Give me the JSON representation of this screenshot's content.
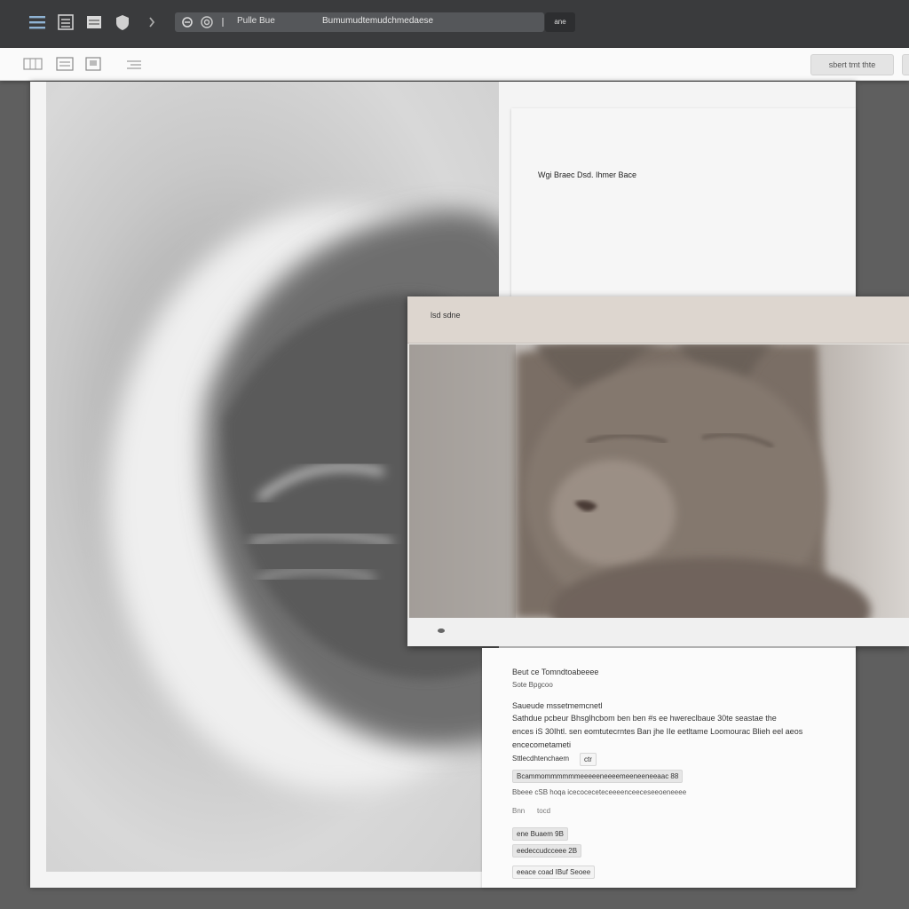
{
  "topbar": {
    "search_text_1": "Pulle Bue",
    "search_text_2": "Bumumudtemudchmedaese",
    "zoom_label": "ane",
    "icons": [
      "menu-icon",
      "list-icon",
      "document-icon",
      "shield-icon",
      "chevron-icon",
      "link-icon",
      "target-icon",
      "text-cursor-icon"
    ]
  },
  "toolbar": {
    "button_label": "sbert tmt thte",
    "icons": [
      "grid-icon",
      "image-icon",
      "frame-icon",
      "align-icon"
    ]
  },
  "doc_top": {
    "title": "Wgi Braec Dsd. Ihmer Bace"
  },
  "image_window": {
    "title": "lsd sdne"
  },
  "doc_bottom": {
    "line1": "Beut ce Tomndtoabeeee",
    "line2": "Sote Bpgcoo",
    "line3": "Saueude mssetmemcnetl",
    "line4": "Sathdue pcbeur Bhsglhcbom ben ben #s ee hwereclbaue 30te seastae the",
    "line5": "ences iS 30Ihtl. sen eomtutecrntes Ban jhe IIe eetltame Loomourac Blieh eel aeos",
    "line6": "encecometameti",
    "chip_small_text": "Sttlecdhtenchaem",
    "chip_small_badge": "ctr",
    "chip_wide": "Bcammommmmmmeeeeeneeeemeeneeneeaac 88",
    "line_after_chip": "Bbeee cSB hoqa icecoceceteceeeenceeceseeoeneeee",
    "small_label_1": "Bnn",
    "small_label_2": "tocd",
    "chip_a": "ene Buaem 9B",
    "chip_b": "eedeccudcceee 2B",
    "footer_text": "eeace coad IBuf Seoee"
  }
}
